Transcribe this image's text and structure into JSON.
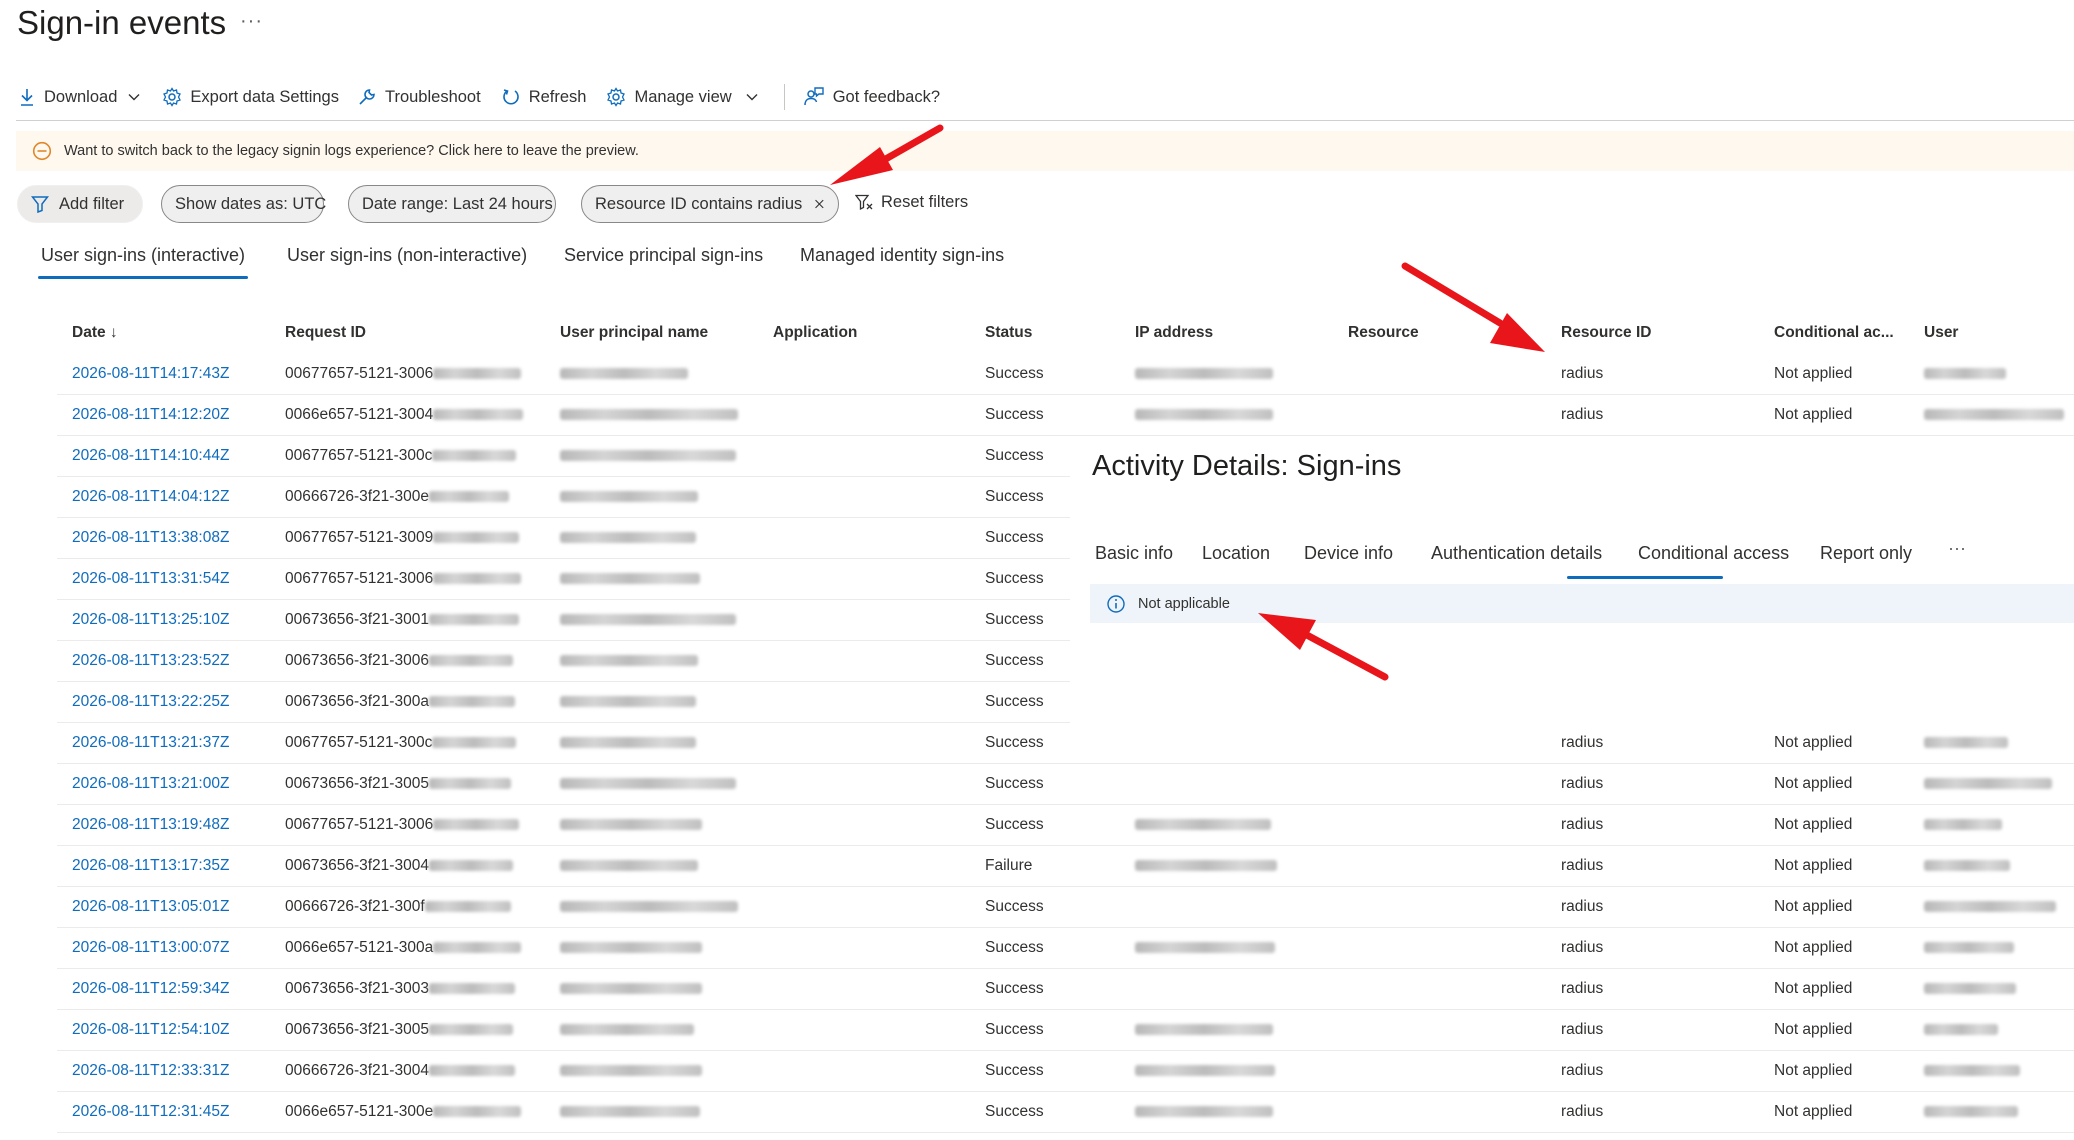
{
  "page": {
    "title": "Sign-in events",
    "more": "···"
  },
  "toolbar": {
    "download": "Download",
    "export": "Export data Settings",
    "troubleshoot": "Troubleshoot",
    "refresh": "Refresh",
    "manage_view": "Manage view",
    "feedback": "Got feedback?"
  },
  "banner": {
    "text": "Want to switch back to the legacy signin logs experience? Click here to leave the preview."
  },
  "filters": {
    "add": "Add filter",
    "dates": "Show dates as: UTC",
    "range": "Date range: Last 24 hours",
    "resource": "Resource ID contains radius",
    "reset": "Reset filters"
  },
  "tabs": [
    {
      "label": "User sign-ins (interactive)"
    },
    {
      "label": "User sign-ins (non-interactive)"
    },
    {
      "label": "Service principal sign-ins"
    },
    {
      "label": "Managed identity sign-ins"
    }
  ],
  "columns": {
    "date": "Date",
    "sort_indicator": "↓",
    "request_id": "Request ID",
    "upn": "User principal name",
    "application": "Application",
    "status": "Status",
    "ip": "IP address",
    "resource": "Resource",
    "resource_id": "Resource ID",
    "conditional": "Conditional ac...",
    "user": "User"
  },
  "rows": [
    {
      "date": "2026-08-11T14:17:43Z",
      "request_id": "00677657-5121-3006",
      "status": "Success",
      "resource_id": "radius",
      "conditional": "Not applied",
      "ip_visible": true,
      "user_visible": true
    },
    {
      "date": "2026-08-11T14:12:20Z",
      "request_id": "0066e657-5121-3004",
      "status": "Success",
      "resource_id": "radius",
      "conditional": "Not applied",
      "ip_visible": true,
      "user_visible": true
    },
    {
      "date": "2026-08-11T14:10:44Z",
      "request_id": "00677657-5121-300c",
      "status": "Success",
      "resource_id": "",
      "conditional": "",
      "ip_visible": false,
      "user_visible": false
    },
    {
      "date": "2026-08-11T14:04:12Z",
      "request_id": "00666726-3f21-300e",
      "status": "Success",
      "resource_id": "",
      "conditional": "",
      "ip_visible": false,
      "user_visible": false
    },
    {
      "date": "2026-08-11T13:38:08Z",
      "request_id": "00677657-5121-3009",
      "status": "Success",
      "resource_id": "",
      "conditional": "",
      "ip_visible": false,
      "user_visible": false
    },
    {
      "date": "2026-08-11T13:31:54Z",
      "request_id": "00677657-5121-3006",
      "status": "Success",
      "resource_id": "",
      "conditional": "",
      "ip_visible": false,
      "user_visible": false
    },
    {
      "date": "2026-08-11T13:25:10Z",
      "request_id": "00673656-3f21-3001",
      "status": "Success",
      "resource_id": "",
      "conditional": "",
      "ip_visible": false,
      "user_visible": false
    },
    {
      "date": "2026-08-11T13:23:52Z",
      "request_id": "00673656-3f21-3006",
      "status": "Success",
      "resource_id": "",
      "conditional": "",
      "ip_visible": false,
      "user_visible": false
    },
    {
      "date": "2026-08-11T13:22:25Z",
      "request_id": "00673656-3f21-300a",
      "status": "Success",
      "resource_id": "",
      "conditional": "",
      "ip_visible": false,
      "user_visible": false
    },
    {
      "date": "2026-08-11T13:21:37Z",
      "request_id": "00677657-5121-300c",
      "status": "Success",
      "resource_id": "radius",
      "conditional": "Not applied",
      "ip_visible": false,
      "user_visible": true
    },
    {
      "date": "2026-08-11T13:21:00Z",
      "request_id": "00673656-3f21-3005",
      "status": "Success",
      "resource_id": "radius",
      "conditional": "Not applied",
      "ip_visible": false,
      "user_visible": true
    },
    {
      "date": "2026-08-11T13:19:48Z",
      "request_id": "00677657-5121-3006",
      "status": "Success",
      "resource_id": "radius",
      "conditional": "Not applied",
      "ip_visible": true,
      "user_visible": true
    },
    {
      "date": "2026-08-11T13:17:35Z",
      "request_id": "00673656-3f21-3004",
      "status": "Failure",
      "resource_id": "radius",
      "conditional": "Not applied",
      "ip_visible": true,
      "user_visible": true
    },
    {
      "date": "2026-08-11T13:05:01Z",
      "request_id": "00666726-3f21-300f",
      "status": "Success",
      "resource_id": "radius",
      "conditional": "Not applied",
      "ip_visible": false,
      "user_visible": true
    },
    {
      "date": "2026-08-11T13:00:07Z",
      "request_id": "0066e657-5121-300a",
      "status": "Success",
      "resource_id": "radius",
      "conditional": "Not applied",
      "ip_visible": true,
      "user_visible": true
    },
    {
      "date": "2026-08-11T12:59:34Z",
      "request_id": "00673656-3f21-3003",
      "status": "Success",
      "resource_id": "radius",
      "conditional": "Not applied",
      "ip_visible": false,
      "user_visible": true
    },
    {
      "date": "2026-08-11T12:54:10Z",
      "request_id": "00673656-3f21-3005",
      "status": "Success",
      "resource_id": "radius",
      "conditional": "Not applied",
      "ip_visible": true,
      "user_visible": true
    },
    {
      "date": "2026-08-11T12:33:31Z",
      "request_id": "00666726-3f21-3004",
      "status": "Success",
      "resource_id": "radius",
      "conditional": "Not applied",
      "ip_visible": true,
      "user_visible": true
    },
    {
      "date": "2026-08-11T12:31:45Z",
      "request_id": "0066e657-5121-300e",
      "status": "Success",
      "resource_id": "radius",
      "conditional": "Not applied",
      "ip_visible": true,
      "user_visible": true
    }
  ],
  "details": {
    "title": "Activity Details: Sign-ins",
    "tabs": [
      {
        "label": "Basic info"
      },
      {
        "label": "Location"
      },
      {
        "label": "Device info"
      },
      {
        "label": "Authentication details"
      },
      {
        "label": "Conditional access"
      },
      {
        "label": "Report only"
      }
    ],
    "active_tab": "Conditional access",
    "more": "···",
    "info_text": "Not applicable"
  },
  "colors": {
    "accent": "#0f6cbd",
    "arrow": "#e8151b",
    "banner_bg": "#fef8ef",
    "info_bg": "#eef4fa",
    "warning_icon": "#e0872b"
  }
}
